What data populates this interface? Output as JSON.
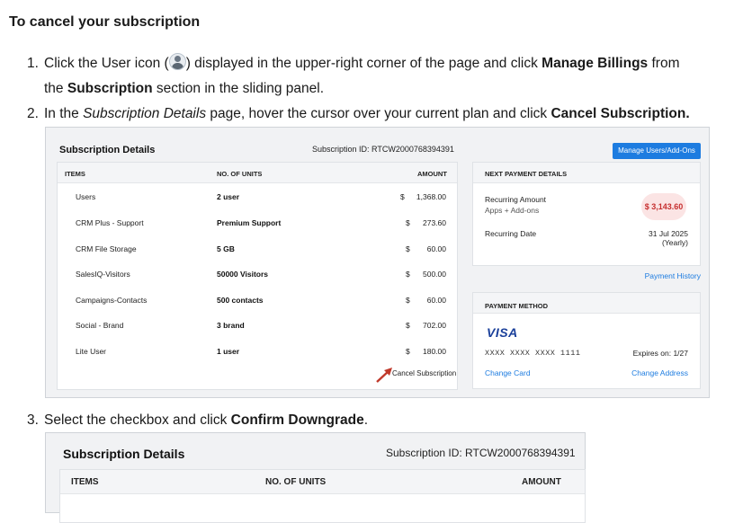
{
  "heading": "To cancel your subscription",
  "steps": {
    "s1": {
      "num": "1.",
      "pre": "Click the User icon (",
      "post": ") displayed in the upper-right corner of the page and click",
      "bold1": "Manage Billings",
      "mid": "from",
      "line2_pre": "the",
      "bold2": "Subscription",
      "line2_post": "section in the sliding panel."
    },
    "s2": {
      "num": "2.",
      "pre": "In the",
      "ital": "Subscription Details",
      "mid": "page, hover the cursor over your current plan and click",
      "bold": "Cancel Subscription."
    },
    "s3": {
      "num": "3.",
      "pre": "Select the checkbox and click",
      "bold": "Confirm Downgrade",
      "post": "."
    }
  },
  "shot1": {
    "title": "Subscription Details",
    "subscription_id": "Subscription ID: RTCW2000768394391",
    "manage_button": "Manage Users/Add-Ons",
    "columns": {
      "items": "ITEMS",
      "units": "NO. OF UNITS",
      "amount": "AMOUNT"
    },
    "rows": [
      {
        "item": "Users",
        "units": "2 user",
        "cur": "$",
        "amount": "1,368.00"
      },
      {
        "item": "CRM Plus - Support",
        "units": "Premium Support",
        "cur": "$",
        "amount": "273.60"
      },
      {
        "item": "CRM File Storage",
        "units": "5 GB",
        "cur": "$",
        "amount": "60.00"
      },
      {
        "item": "SalesIQ-Visitors",
        "units": "50000 Visitors",
        "cur": "$",
        "amount": "500.00"
      },
      {
        "item": "Campaigns-Contacts",
        "units": "500 contacts",
        "cur": "$",
        "amount": "60.00"
      },
      {
        "item": "Social - Brand",
        "units": "3 brand",
        "cur": "$",
        "amount": "702.00"
      },
      {
        "item": "Lite User",
        "units": "1 user",
        "cur": "$",
        "amount": "180.00"
      }
    ],
    "cancel_link": "Cancel Subscription",
    "next_payment": {
      "header": "NEXT PAYMENT DETAILS",
      "recurring_amount_label": "Recurring Amount",
      "recurring_amount_sub": "Apps + Add-ons",
      "amount": "$ 3,143.60",
      "recurring_date_label": "Recurring Date",
      "date": "31 Jul 2025",
      "cycle": "(Yearly)"
    },
    "payment_history": "Payment History",
    "payment_method": {
      "header": "PAYMENT METHOD",
      "brand": "VISA",
      "card_number": "XXXX XXXX XXXX 1111",
      "expires": "Expires on: 1/27",
      "change_card": "Change Card",
      "change_address": "Change Address"
    },
    "arrow_color": "#c0392b"
  },
  "shot2": {
    "title": "Subscription Details",
    "subscription_id": "Subscription ID: RTCW2000768394391",
    "columns": {
      "items": "ITEMS",
      "units": "NO. OF UNITS",
      "amount": "AMOUNT"
    }
  },
  "colors": {
    "accent": "#1d7ce0",
    "badge_text": "#c62f2f",
    "badge_bg": "#fbe4e4"
  }
}
